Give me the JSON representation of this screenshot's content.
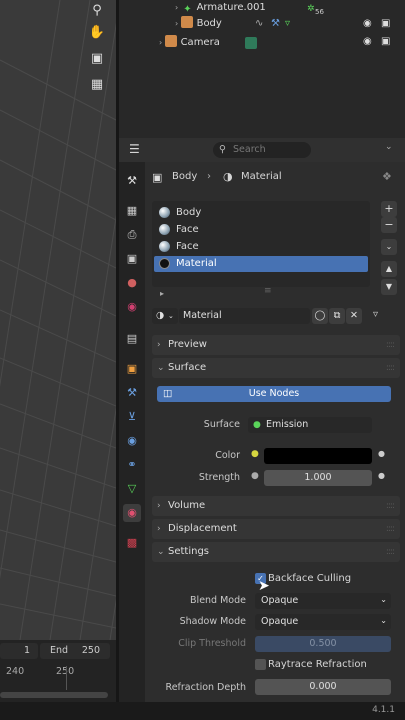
{
  "outliner": {
    "rows": [
      {
        "label": "Armature.001",
        "badge": "56"
      },
      {
        "label": "Body"
      },
      {
        "label": "Camera"
      }
    ]
  },
  "header": {
    "search_placeholder": "Search"
  },
  "breadcrumb": {
    "object": "Body",
    "material": "Material"
  },
  "material_slots": [
    "Body",
    "Face",
    "Face",
    "Material"
  ],
  "material_name": "Material",
  "panels": {
    "preview": "Preview",
    "surface": "Surface",
    "volume": "Volume",
    "displacement": "Displacement",
    "settings": "Settings"
  },
  "surface": {
    "use_nodes": "Use Nodes",
    "surface_label": "Surface",
    "surface_value": "Emission",
    "color_label": "Color",
    "strength_label": "Strength",
    "strength_value": "1.000"
  },
  "settings": {
    "backface_culling": "Backface Culling",
    "blend_mode_label": "Blend Mode",
    "blend_mode_value": "Opaque",
    "shadow_mode_label": "Shadow Mode",
    "shadow_mode_value": "Opaque",
    "clip_threshold_label": "Clip Threshold",
    "clip_threshold_value": "0.500",
    "raytrace_refraction": "Raytrace Refraction",
    "refraction_depth_label": "Refraction Depth",
    "refraction_depth_value": "0.000"
  },
  "timeline": {
    "start": "1",
    "end_label": "End",
    "end_value": "250",
    "tick_a": "240",
    "tick_b": "250"
  },
  "status": {
    "version": "4.1.1"
  },
  "colors": {
    "accent": "#4772b3",
    "color_swatch": "#000000"
  }
}
